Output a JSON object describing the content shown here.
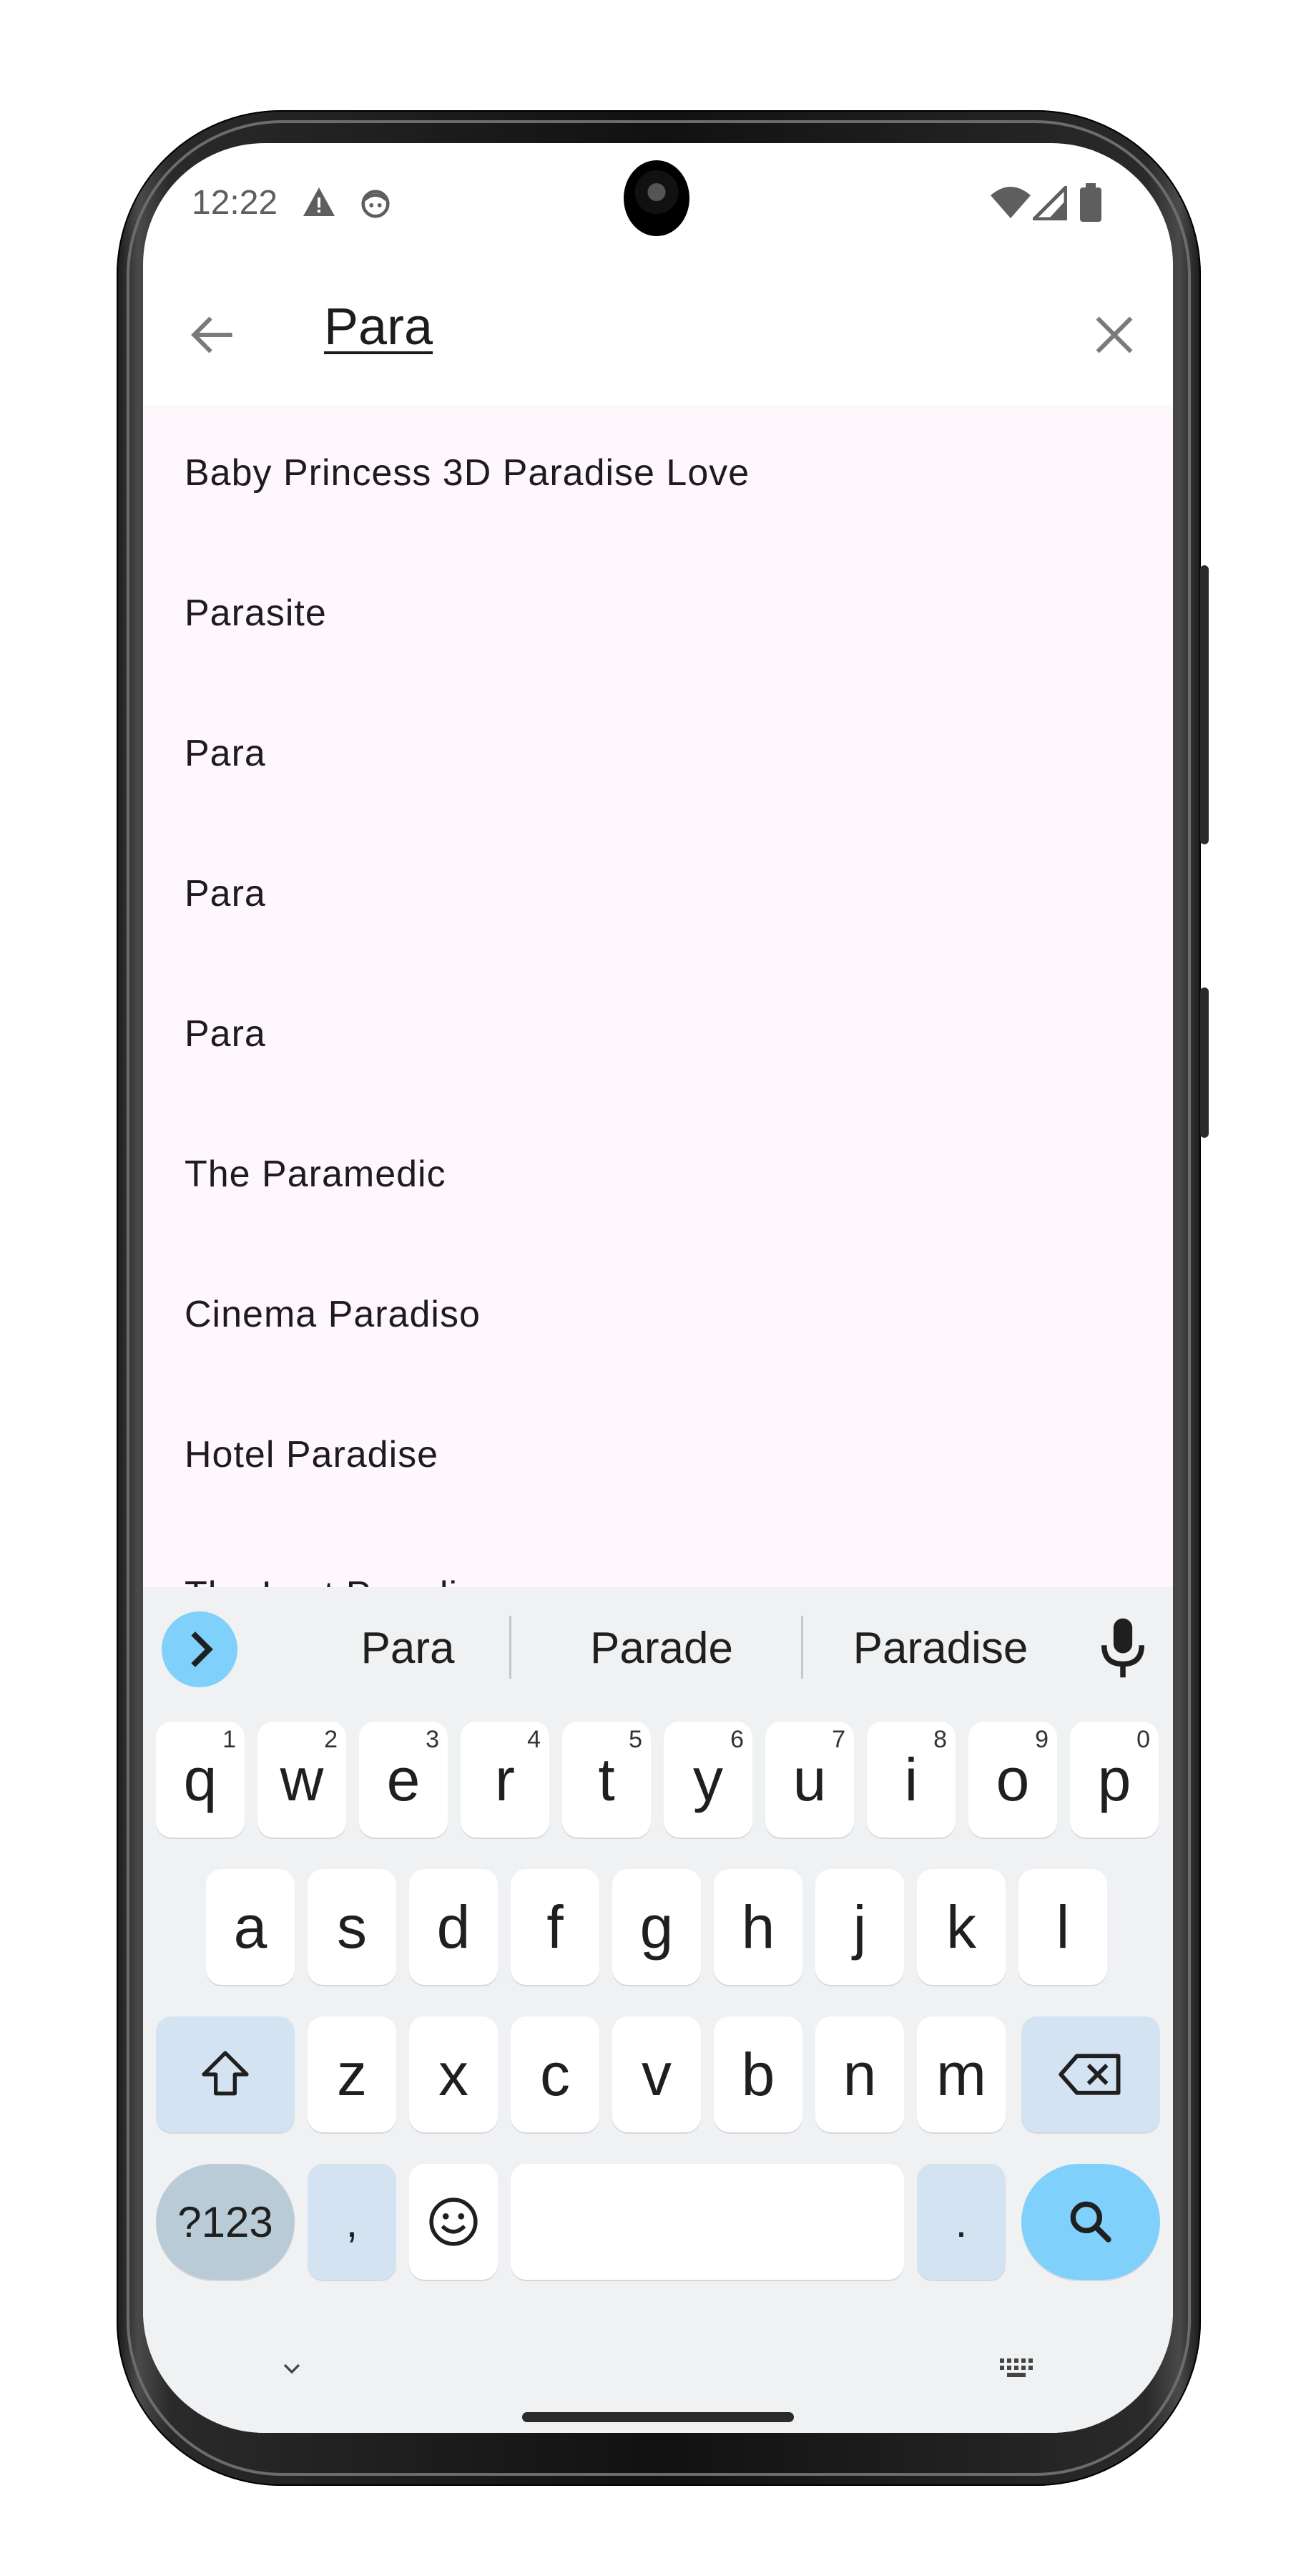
{
  "status_bar": {
    "time": "12:22"
  },
  "header": {
    "query": "Para"
  },
  "results": [
    "Baby Princess 3D Paradise Love",
    "Parasite",
    "Para",
    "Para",
    "Para",
    "The Paramedic",
    "Cinema Paradiso",
    "Hotel Paradise",
    "The Last Paradise"
  ],
  "keyboard": {
    "suggestions": [
      "Para",
      "Parade",
      "Paradise"
    ],
    "row1": [
      {
        "k": "q",
        "h": "1"
      },
      {
        "k": "w",
        "h": "2"
      },
      {
        "k": "e",
        "h": "3"
      },
      {
        "k": "r",
        "h": "4"
      },
      {
        "k": "t",
        "h": "5"
      },
      {
        "k": "y",
        "h": "6"
      },
      {
        "k": "u",
        "h": "7"
      },
      {
        "k": "i",
        "h": "8"
      },
      {
        "k": "o",
        "h": "9"
      },
      {
        "k": "p",
        "h": "0"
      }
    ],
    "row2": [
      "a",
      "s",
      "d",
      "f",
      "g",
      "h",
      "j",
      "k",
      "l"
    ],
    "row3": [
      "z",
      "x",
      "c",
      "v",
      "b",
      "n",
      "m"
    ],
    "symbols_label": "?123",
    "comma_label": ",",
    "period_label": "."
  },
  "colors": {
    "accent": "#7fd0fb",
    "list_bg": "#fef7fb",
    "keyboard_bg": "#eff1f3"
  },
  "icons": [
    "warning-icon",
    "android-face-icon",
    "wifi-icon",
    "signal-icon",
    "battery-icon",
    "back-arrow-icon",
    "close-icon",
    "chevron-right-icon",
    "mic-icon",
    "shift-icon",
    "backspace-icon",
    "emoji-icon",
    "search-icon",
    "chevron-down-icon",
    "keyboard-icon"
  ]
}
